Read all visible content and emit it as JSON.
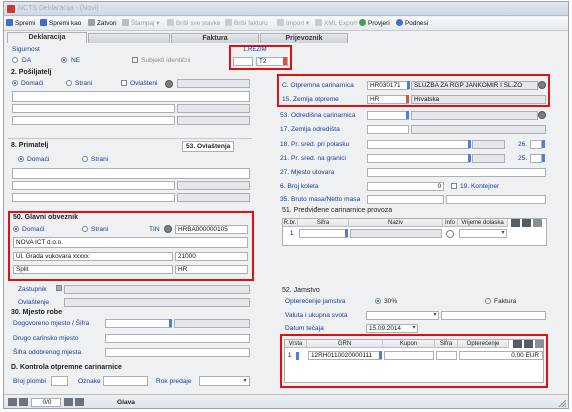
{
  "window": {
    "title": "NCTS Deklaracija - (Novi)"
  },
  "toolbar": {
    "save": "Spremi",
    "save_as": "Spremi kao",
    "close": "Zatvori",
    "print": "Štampaj",
    "delete_items": "Briši sve stavke",
    "delete_invoice": "Briši fakturu",
    "import": "Import",
    "xml_export": "XML Export",
    "check": "Provjeri",
    "send": "Podnesi"
  },
  "tabs": [
    "Deklaracija",
    "",
    "Faktura",
    "Prijevoznik"
  ],
  "left": {
    "sigurnost": {
      "label": "Sigurnost",
      "opt_da": "DA",
      "opt_ne": "NE",
      "subjekti": "Subjekti identični"
    },
    "rezim": {
      "label": "1.REŽIM",
      "value": "T2"
    },
    "posiljatelj": {
      "label": "2. Pošiljatelj",
      "domaci": "Domaći",
      "strani": "Strani",
      "ovlasteni": "Ovlašteni"
    },
    "primatelj": {
      "label": "8. Primatelj",
      "ovlastenja": "53. Ovlaštenja",
      "domaci": "Domaći",
      "strani": "Strani"
    },
    "obveznik": {
      "label": "50. Glavni obveznik",
      "domaci": "Domaći",
      "strani": "Strani",
      "tin_label": "TIN",
      "tin": "HRBA000000105",
      "name": "NOVA ICT d.o.o.",
      "street": "Ul. Grada vukovara xxxxx",
      "zip": "21000",
      "city": "Split",
      "country": "HR"
    },
    "zastupnik": "Zastupnik",
    "ovlastenje": "Ovlaštenje",
    "mjesto": {
      "label": "30. Mjesto robe",
      "dogovoreno": "Dogovoreno mjesto / Šifra",
      "drugo": "Drugo carinsko mjesto",
      "sifra_odob": "Šifra odobrenog mjesta"
    },
    "kontrola": {
      "label": "D. Kontrola otpremne carinarnice",
      "broj_plombi": "Broj plombi",
      "oznake": "Oznake",
      "rok": "Rok predaje"
    }
  },
  "right": {
    "otpremna": {
      "label": "C. Otpremna carinarnica",
      "code": "HR030171",
      "name": "SLUŽBA ZA RGP JANKOMIR I SL.ZO"
    },
    "zemlja": {
      "label": "15. Zemlja otpreme",
      "code": "HR",
      "name": "Hrvatska"
    },
    "odredisna": "53. Odredišna carinarnica",
    "zemlja_odred": "17. Zemlja odredišta",
    "pr_pol": "18. Pr. sred. pri polasku",
    "pr_gran": "21. Pr. sred. na granici",
    "n26": "26.",
    "n25": "25.",
    "utovar": "27. Mjesto utovara",
    "koleta": {
      "label": "6. Broj koleta",
      "value": "0"
    },
    "kontejner": "19. Kontejner",
    "bruto": "35. Bruto masa/Netto masa",
    "provoz": {
      "label": "51. Predviđene carinarnice provoza",
      "cols": [
        "R.br.",
        "Šifra",
        "Naziv",
        "Info",
        "Vrijeme dolaska"
      ],
      "row_no": "1"
    },
    "jamstvo": {
      "label": "52. Jamstvo",
      "opterecenje": "Opterećenje jamstva",
      "pct": "30%",
      "faktura": "Faktura",
      "valuta": "Valuta i ukupna svota",
      "datum": "Datum tečaja",
      "datum_val": "15.09.2014",
      "cols": [
        "Vrsta",
        "GRN",
        "Kupon",
        "Šifra",
        "Opterećenje"
      ],
      "row": {
        "vrsta": "1",
        "grn": "12RH0110020000111",
        "kupon": "",
        "sifra": "",
        "iznos": "0,00 EUR"
      }
    }
  },
  "status": {
    "page": "0/0",
    "label": "Glava"
  }
}
